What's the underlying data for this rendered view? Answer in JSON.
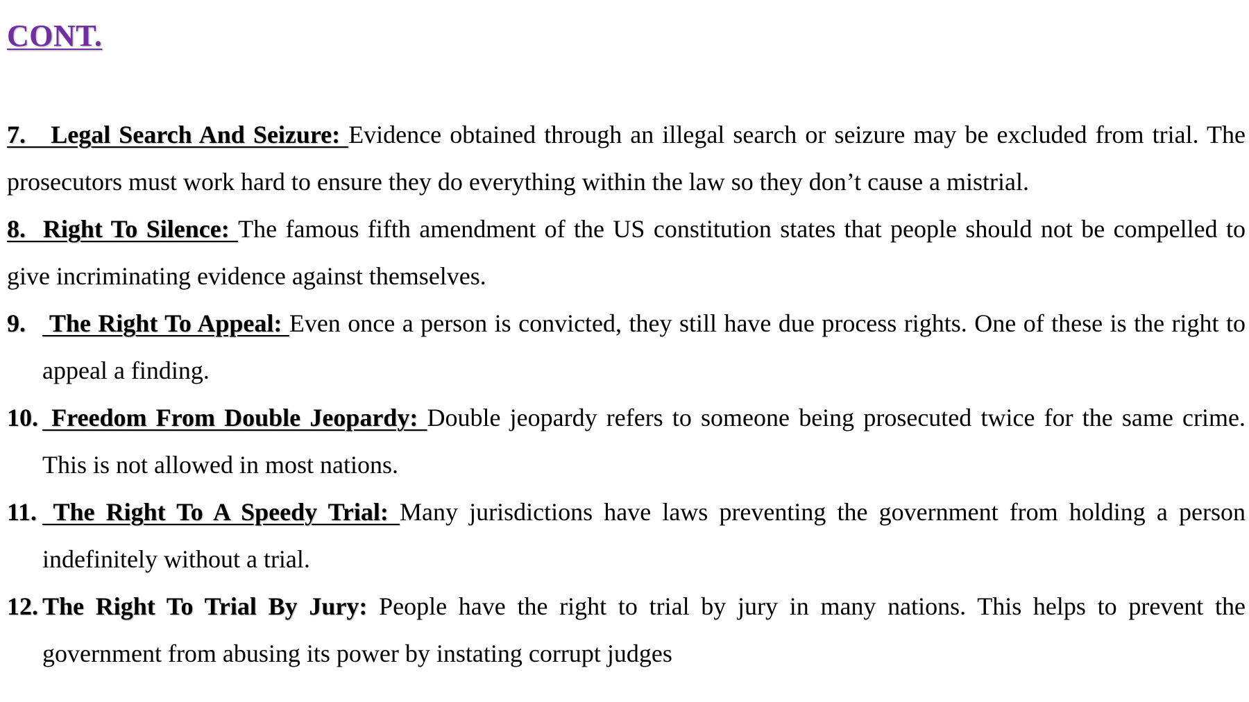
{
  "heading": "CONT.",
  "items": [
    {
      "number": "7.",
      "title": "   Legal Search And Seizure: ",
      "text": "Evidence obtained through an illegal search or seizure may be excluded from trial. The prosecutors must work hard to ensure they do everything within the law so they don’t cause a mistrial."
    },
    {
      "number": "8.",
      "title": "  Right To Silence: ",
      "text": "The famous fifth amendment of the US constitution states that people should not be compelled to give incriminating evidence against themselves."
    },
    {
      "number": "9.",
      "title": " The Right To Appeal: ",
      "text": "Even once a person is convicted, they still have due process rights. One of these is the right to appeal a finding."
    },
    {
      "number": "10.",
      "title": " Freedom From Double Jeopardy: ",
      "text": "Double jeopardy refers to someone being prosecuted twice for the same crime. This is not allowed in most nations."
    },
    {
      "number": "11.",
      "title": " The Right To A Speedy Trial: ",
      "text": "Many jurisdictions have laws preventing the government from holding a person indefinitely without a trial."
    },
    {
      "number": "12.",
      "title": "The Right To Trial By Jury:",
      "text": " People have the right to trial by jury in many nations. This helps to prevent the government from abusing its power by instating corrupt judges"
    }
  ]
}
